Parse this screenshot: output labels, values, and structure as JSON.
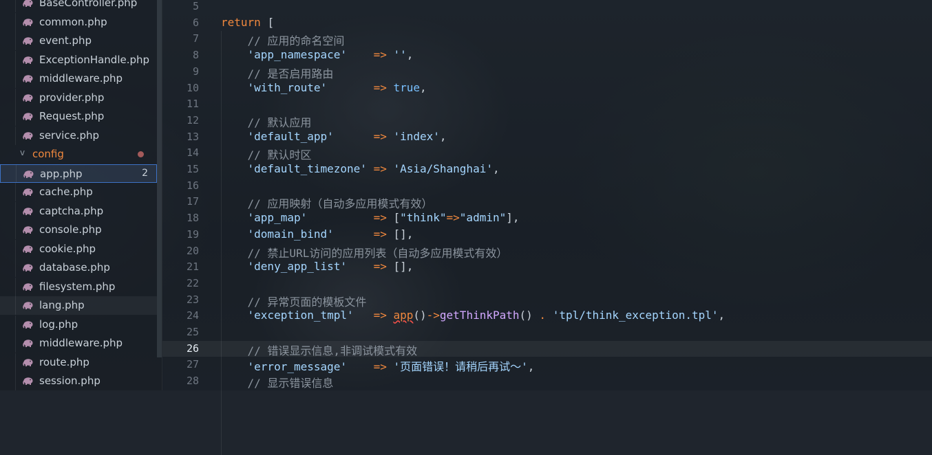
{
  "sidebar": {
    "files_top": [
      {
        "name": "BaseController.php"
      },
      {
        "name": "common.php"
      },
      {
        "name": "event.php"
      },
      {
        "name": "ExceptionHandle.php"
      },
      {
        "name": "middleware.php"
      },
      {
        "name": "provider.php"
      },
      {
        "name": "Request.php"
      },
      {
        "name": "service.php"
      }
    ],
    "folder": {
      "name": "config",
      "chevron": "chevron-down-icon"
    },
    "selected_file": {
      "name": "app.php",
      "badge": "2"
    },
    "files_config": [
      {
        "name": "cache.php"
      },
      {
        "name": "captcha.php"
      },
      {
        "name": "console.php"
      },
      {
        "name": "cookie.php"
      },
      {
        "name": "database.php"
      },
      {
        "name": "filesystem.php"
      },
      {
        "name": "lang.php"
      },
      {
        "name": "log.php"
      },
      {
        "name": "middleware.php"
      },
      {
        "name": "route.php"
      },
      {
        "name": "session.php"
      }
    ],
    "icon": "php-elephant-icon",
    "colors": {
      "file_icon": "#b48ead",
      "folder": "#f0883e",
      "selection_border": "#3d72c6"
    }
  },
  "editor": {
    "current_line": "26",
    "lines": [
      {
        "n": "5",
        "tokens": []
      },
      {
        "n": "6",
        "tokens": [
          {
            "t": "kw",
            "v": "return"
          },
          {
            "t": "punc",
            "v": " "
          },
          {
            "t": "punc",
            "v": "["
          }
        ]
      },
      {
        "n": "7",
        "tokens": [
          {
            "t": "cm",
            "v": "    // 应用的命名空间"
          }
        ]
      },
      {
        "n": "8",
        "tokens": [
          {
            "t": "str",
            "v": "    'app_namespace'"
          },
          {
            "t": "punc",
            "v": "    "
          },
          {
            "t": "op",
            "v": "=>"
          },
          {
            "t": "punc",
            "v": " "
          },
          {
            "t": "str",
            "v": "''"
          },
          {
            "t": "punc",
            "v": ","
          }
        ]
      },
      {
        "n": "9",
        "tokens": [
          {
            "t": "cm",
            "v": "    // 是否启用路由"
          }
        ]
      },
      {
        "n": "10",
        "tokens": [
          {
            "t": "str",
            "v": "    'with_route'"
          },
          {
            "t": "punc",
            "v": "       "
          },
          {
            "t": "op",
            "v": "=>"
          },
          {
            "t": "punc",
            "v": " "
          },
          {
            "t": "bool",
            "v": "true"
          },
          {
            "t": "punc",
            "v": ","
          }
        ]
      },
      {
        "n": "11",
        "tokens": []
      },
      {
        "n": "12",
        "tokens": [
          {
            "t": "cm",
            "v": "    // 默认应用"
          }
        ]
      },
      {
        "n": "13",
        "tokens": [
          {
            "t": "str",
            "v": "    'default_app'"
          },
          {
            "t": "punc",
            "v": "      "
          },
          {
            "t": "op",
            "v": "=>"
          },
          {
            "t": "punc",
            "v": " "
          },
          {
            "t": "str",
            "v": "'index'"
          },
          {
            "t": "punc",
            "v": ","
          }
        ]
      },
      {
        "n": "14",
        "tokens": [
          {
            "t": "cm",
            "v": "    // 默认时区"
          }
        ]
      },
      {
        "n": "15",
        "tokens": [
          {
            "t": "str",
            "v": "    'default_timezone'"
          },
          {
            "t": "punc",
            "v": " "
          },
          {
            "t": "op",
            "v": "=>"
          },
          {
            "t": "punc",
            "v": " "
          },
          {
            "t": "str",
            "v": "'Asia/Shanghai'"
          },
          {
            "t": "punc",
            "v": ","
          }
        ]
      },
      {
        "n": "16",
        "tokens": []
      },
      {
        "n": "17",
        "tokens": [
          {
            "t": "cm",
            "v": "    // 应用映射（自动多应用模式有效）"
          }
        ]
      },
      {
        "n": "18",
        "tokens": [
          {
            "t": "str",
            "v": "    'app_map'"
          },
          {
            "t": "punc",
            "v": "          "
          },
          {
            "t": "op",
            "v": "=>"
          },
          {
            "t": "punc",
            "v": " ["
          },
          {
            "t": "str",
            "v": "\"think\""
          },
          {
            "t": "op",
            "v": "=>"
          },
          {
            "t": "str",
            "v": "\"admin\""
          },
          {
            "t": "punc",
            "v": "],"
          }
        ]
      },
      {
        "n": "19",
        "tokens": [
          {
            "t": "str",
            "v": "    'domain_bind'"
          },
          {
            "t": "punc",
            "v": "      "
          },
          {
            "t": "op",
            "v": "=>"
          },
          {
            "t": "punc",
            "v": " [],"
          }
        ]
      },
      {
        "n": "20",
        "tokens": [
          {
            "t": "cm",
            "v": "    // 禁止URL访问的应用列表（自动多应用模式有效）"
          }
        ]
      },
      {
        "n": "21",
        "tokens": [
          {
            "t": "str",
            "v": "    'deny_app_list'"
          },
          {
            "t": "punc",
            "v": "    "
          },
          {
            "t": "op",
            "v": "=>"
          },
          {
            "t": "punc",
            "v": " [],"
          }
        ]
      },
      {
        "n": "22",
        "tokens": []
      },
      {
        "n": "23",
        "tokens": [
          {
            "t": "cm",
            "v": "    // 异常页面的模板文件"
          }
        ]
      },
      {
        "n": "24",
        "tokens": [
          {
            "t": "str",
            "v": "    'exception_tmpl'"
          },
          {
            "t": "punc",
            "v": "   "
          },
          {
            "t": "op",
            "v": "=>"
          },
          {
            "t": "punc",
            "v": " "
          },
          {
            "t": "fnerr",
            "v": "app"
          },
          {
            "t": "punc",
            "v": "()"
          },
          {
            "t": "op",
            "v": "->"
          },
          {
            "t": "fn",
            "v": "getThinkPath"
          },
          {
            "t": "punc",
            "v": "() "
          },
          {
            "t": "op",
            "v": "."
          },
          {
            "t": "punc",
            "v": " "
          },
          {
            "t": "str",
            "v": "'tpl/think_exception.tpl'"
          },
          {
            "t": "punc",
            "v": ","
          }
        ]
      },
      {
        "n": "25",
        "tokens": []
      },
      {
        "n": "26",
        "tokens": [
          {
            "t": "cm",
            "v": "    // 错误显示信息,非调试模式有效"
          }
        ]
      },
      {
        "n": "27",
        "tokens": [
          {
            "t": "str",
            "v": "    'error_message'"
          },
          {
            "t": "punc",
            "v": "    "
          },
          {
            "t": "op",
            "v": "=>"
          },
          {
            "t": "punc",
            "v": " "
          },
          {
            "t": "str",
            "v": "'页面错误！请稍后再试～'"
          },
          {
            "t": "punc",
            "v": ","
          }
        ]
      },
      {
        "n": "28",
        "tokens": [
          {
            "t": "cm",
            "v": "    // 显示错误信息"
          }
        ]
      }
    ],
    "colors": {
      "keyword": "#f0883e",
      "string": "#a5d6ff",
      "comment": "#8b949e",
      "boolean": "#79c0ff",
      "function": "#d2a8ff"
    }
  }
}
